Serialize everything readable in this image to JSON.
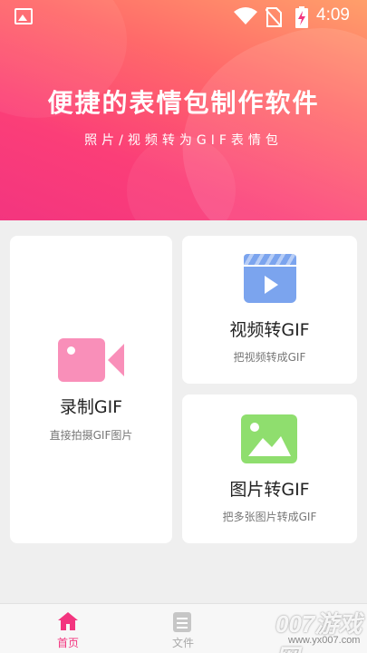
{
  "status_bar": {
    "time": "4:09",
    "icons": [
      "image-notification-icon",
      "wifi-icon",
      "no-sim-icon",
      "battery-charging-icon"
    ]
  },
  "banner": {
    "title": "便捷的表情包制作软件",
    "subtitle": "照片/视频转为GIF表情包",
    "gradient": [
      "#ff9f6a",
      "#fb3e78"
    ]
  },
  "cards": {
    "record": {
      "title": "录制GIF",
      "desc": "直接拍摄GIF图片",
      "icon": "video-camera-icon",
      "color": "#f98fb9"
    },
    "video": {
      "title": "视频转GIF",
      "desc": "把视频转成GIF",
      "icon": "video-clapper-icon",
      "color": "#7ba4ee"
    },
    "image": {
      "title": "图片转GIF",
      "desc": "把多张图片转成GIF",
      "icon": "image-icon",
      "color": "#8fde6e"
    }
  },
  "tabbar": {
    "home": {
      "label": "首页",
      "icon": "home-icon",
      "active": true,
      "color": "#f3357f"
    },
    "files": {
      "label": "文件",
      "icon": "file-icon",
      "active": false
    }
  },
  "watermark": {
    "text": "007游戏网",
    "url": "www.yx007.com"
  }
}
